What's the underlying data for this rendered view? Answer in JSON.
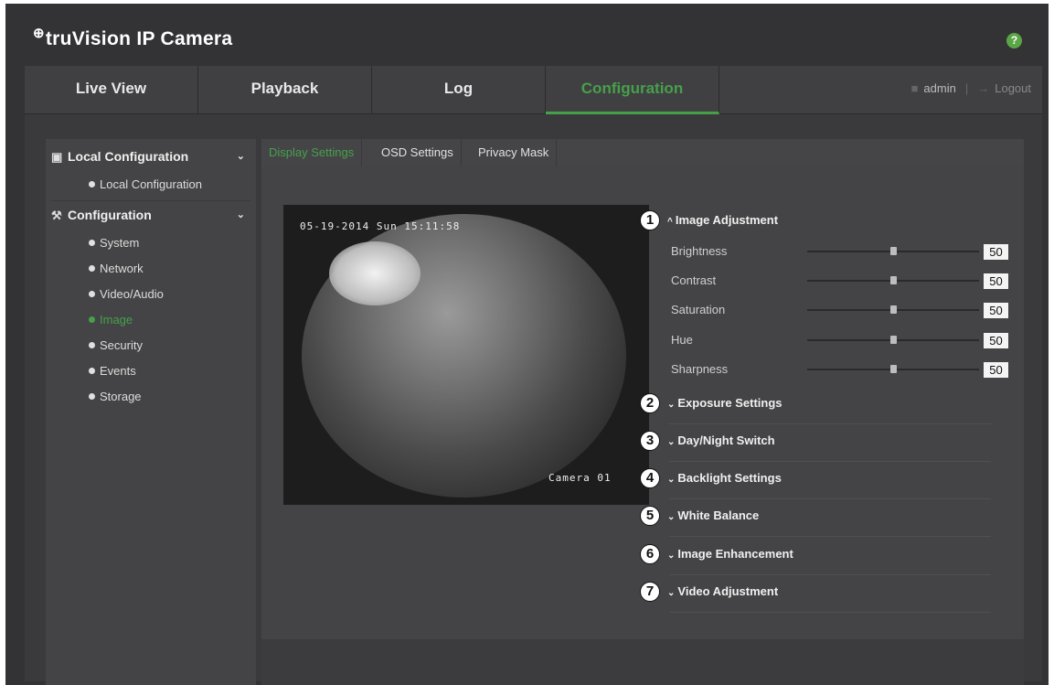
{
  "brand": {
    "logo_glyph": "⊕",
    "title": "truVision IP Camera"
  },
  "colors": {
    "accent": "#46a04a",
    "background": "#333335",
    "panel": "#444446"
  },
  "nav": {
    "tabs": [
      {
        "label": "Live View",
        "active": false
      },
      {
        "label": "Playback",
        "active": false
      },
      {
        "label": "Log",
        "active": false
      },
      {
        "label": "Configuration",
        "active": true
      }
    ],
    "user": "admin",
    "logout": "Logout"
  },
  "sidebar": {
    "local_header": "Local Configuration",
    "local_items": [
      {
        "label": "Local Configuration"
      }
    ],
    "config_header": "Configuration",
    "config_items": [
      {
        "label": "System"
      },
      {
        "label": "Network"
      },
      {
        "label": "Video/Audio"
      },
      {
        "label": "Image",
        "active": true
      },
      {
        "label": "Security"
      },
      {
        "label": "Events"
      },
      {
        "label": "Storage"
      }
    ]
  },
  "subtabs": [
    {
      "label": "Display Settings",
      "active": true
    },
    {
      "label": "OSD Settings"
    },
    {
      "label": "Privacy Mask"
    }
  ],
  "preview": {
    "osd_time": "05-19-2014 Sun 15:11:58",
    "osd_camera": "Camera 01"
  },
  "sections": [
    {
      "number": "1",
      "label": "Image Adjustment",
      "expanded": true
    },
    {
      "number": "2",
      "label": "Exposure Settings",
      "expanded": false
    },
    {
      "number": "3",
      "label": "Day/Night Switch",
      "expanded": false
    },
    {
      "number": "4",
      "label": "Backlight Settings",
      "expanded": false
    },
    {
      "number": "5",
      "label": "White Balance",
      "expanded": false
    },
    {
      "number": "6",
      "label": "Image Enhancement",
      "expanded": false
    },
    {
      "number": "7",
      "label": "Video Adjustment",
      "expanded": false
    }
  ],
  "sliders": [
    {
      "label": "Brightness",
      "value": "50",
      "level": 0.5
    },
    {
      "label": "Contrast",
      "value": "50",
      "level": 0.5
    },
    {
      "label": "Saturation",
      "value": "50",
      "level": 0.5
    },
    {
      "label": "Hue",
      "value": "50",
      "level": 0.5
    },
    {
      "label": "Sharpness",
      "value": "50",
      "level": 0.5
    }
  ]
}
